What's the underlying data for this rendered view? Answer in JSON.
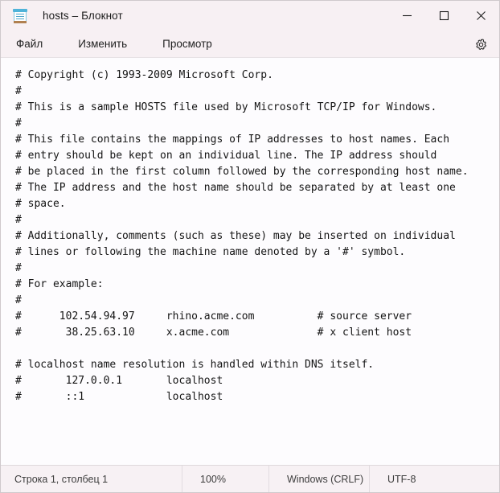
{
  "window": {
    "title": "hosts – Блокнот",
    "app_icon": "notepad-icon"
  },
  "titlebar": {
    "minimize_label": "Свернуть",
    "maximize_label": "Развернуть",
    "close_label": "Закрыть"
  },
  "menubar": {
    "items": [
      {
        "label": "Файл"
      },
      {
        "label": "Изменить"
      },
      {
        "label": "Просмотр"
      }
    ],
    "settings_icon": "gear-icon"
  },
  "editor": {
    "content": "# Copyright (c) 1993-2009 Microsoft Corp.\n#\n# This is a sample HOSTS file used by Microsoft TCP/IP for Windows.\n#\n# This file contains the mappings of IP addresses to host names. Each\n# entry should be kept on an individual line. The IP address should\n# be placed in the first column followed by the corresponding host name.\n# The IP address and the host name should be separated by at least one\n# space.\n#\n# Additionally, comments (such as these) may be inserted on individual\n# lines or following the machine name denoted by a '#' symbol.\n#\n# For example:\n#\n#      102.54.94.97     rhino.acme.com          # source server\n#       38.25.63.10     x.acme.com              # x client host\n\n# localhost name resolution is handled within DNS itself.\n#\t127.0.0.1       localhost\n#\t::1             localhost"
  },
  "statusbar": {
    "position": "Строка 1, столбец 1",
    "zoom": "100%",
    "line_ending": "Windows (CRLF)",
    "encoding": "UTF-8"
  },
  "colors": {
    "chrome": "#f7f0f3",
    "editor_bg": "#fdfcfe",
    "text": "#141414",
    "border": "#cfc9cc",
    "icon_blue": "#4fb3d9",
    "icon_base": "#b08050"
  }
}
